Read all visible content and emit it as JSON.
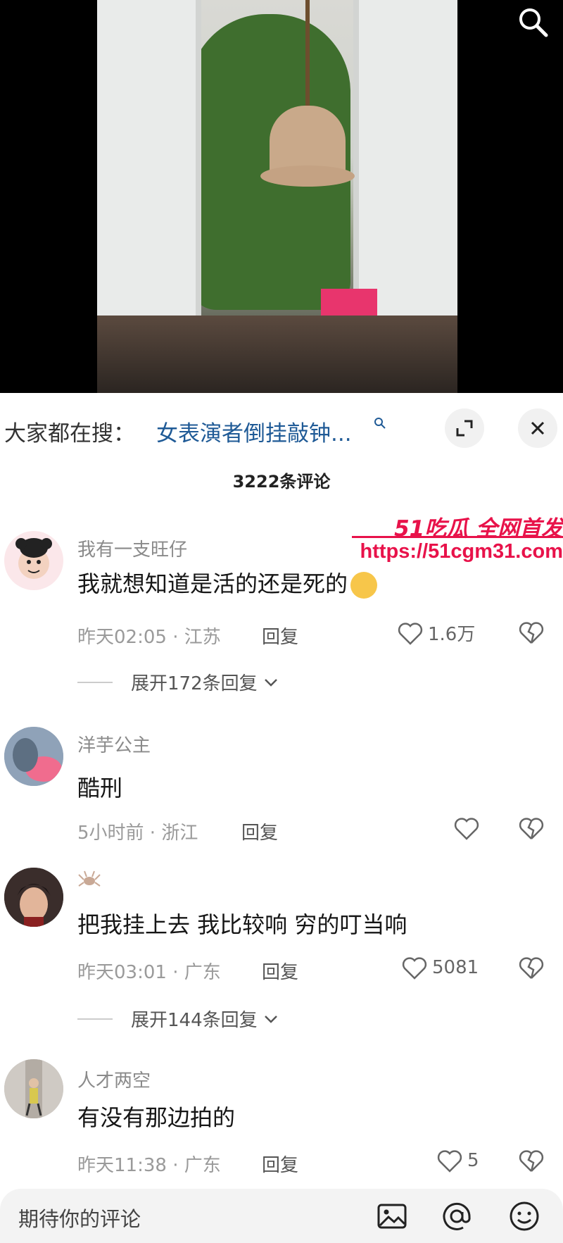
{
  "search": {
    "prefix": "大家都在搜：",
    "query": "女表演者倒挂敲钟...",
    "query_icon": "search-small-icon"
  },
  "comments_header": {
    "count_label": "3222条评论"
  },
  "watermark": {
    "title": "51吃瓜 全网首发",
    "url": "https://51cgm31.com"
  },
  "comments": [
    {
      "user": "我有一支旺仔",
      "text": "我就想知道是活的还是死的",
      "time_loc": "昨天02:05 · 江苏",
      "reply": "回复",
      "likes": "1.6万",
      "expand": "展开172条回复"
    },
    {
      "user": "洋芋公主",
      "text": "酷刑",
      "time_loc": "5小时前 · 浙江",
      "reply": "回复",
      "likes": "",
      "expand": ""
    },
    {
      "user": "",
      "text": "把我挂上去 我比较响 穷的叮当响",
      "time_loc": "昨天03:01 · 广东",
      "reply": "回复",
      "likes": "5081",
      "expand": "展开144条回复"
    },
    {
      "user": "人才两空",
      "text": "有没有那边拍的",
      "time_loc": "昨天11:38 · 广东",
      "reply": "回复",
      "likes": "5",
      "expand": ""
    }
  ],
  "input": {
    "placeholder": "期待你的评论"
  },
  "colors": {
    "accent_link": "#1f5a96",
    "watermark": "#e8124a"
  }
}
